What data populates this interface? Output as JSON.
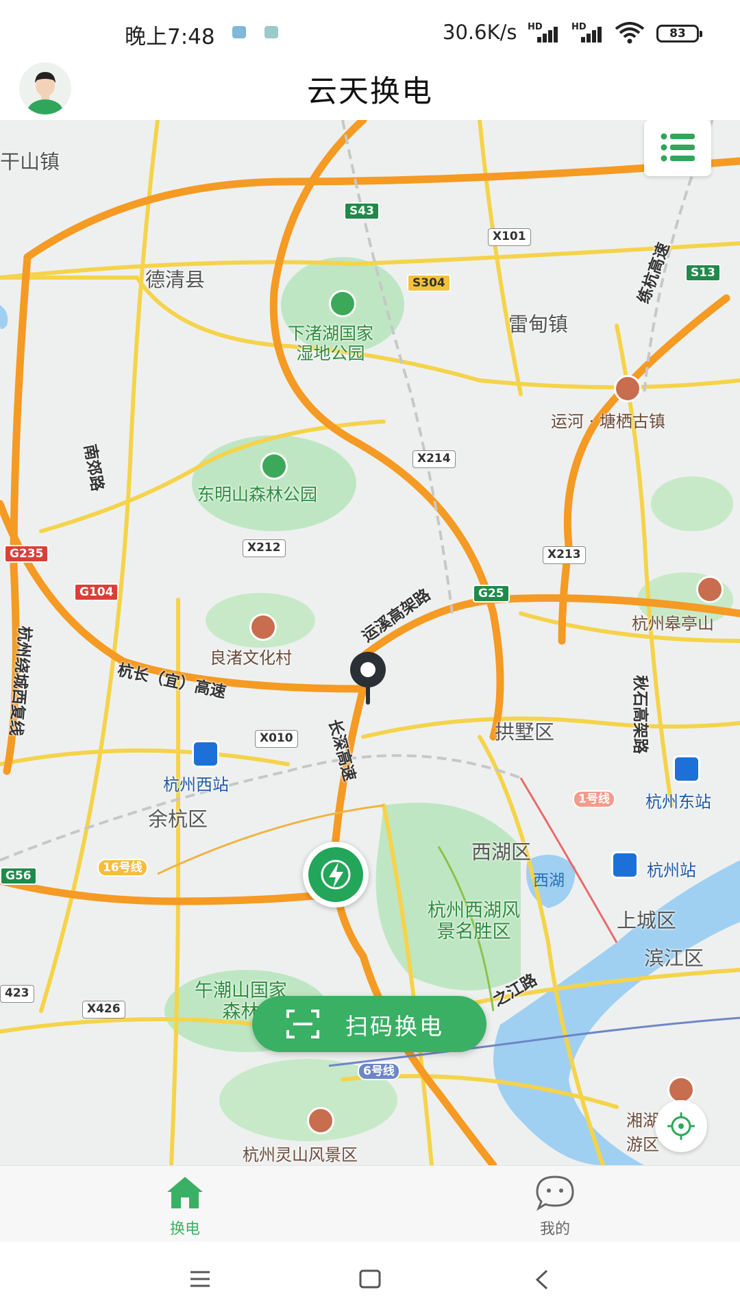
{
  "status_bar": {
    "time": "晚上7:48",
    "speed": "30.6K/s",
    "network_badge": "HD",
    "battery": "83",
    "icons": [
      "camera-app-icon",
      "gallery-app-icon",
      "signal-icon",
      "signal-icon",
      "wifi-icon",
      "battery-icon"
    ]
  },
  "header": {
    "title": "云天换电",
    "avatar": "user-avatar-icon"
  },
  "map": {
    "places": {
      "ganshan": "干山镇",
      "deqing": "德清县",
      "leidian": "雷甸镇",
      "gongshu": "拱墅区",
      "yuhang": "余杭区",
      "xihu_district": "西湖区",
      "shangcheng": "上城区",
      "binjiang": "滨江区"
    },
    "parks": {
      "xiazhuhu": "下渚湖国家\n湿地公园",
      "dongmingshan": "东明山森林公园",
      "xihu_scenic": "杭州西湖风\n景名胜区",
      "wuchaoshan": "午潮山国家\n森林",
      "lingshan": "杭州灵山风景区"
    },
    "pois": {
      "yunhe": "运河 · 塘栖古镇",
      "liangzhu": "良渚文化村",
      "gaoting": "杭州皋亭山",
      "xianghu": "湘湖旅\n游区"
    },
    "stations": {
      "west": "杭州西站",
      "east": "杭州东站",
      "city": "杭州站"
    },
    "roads": {
      "nanjiao": "南郊路",
      "lianghang": "练杭高速",
      "yunxi": "运溪高架路",
      "hangchang": "杭长（宜）高速",
      "changshen": "长深高速",
      "qiushi": "秋石高架路",
      "raocheng": "杭州绕城西复线",
      "zhijiang": "之江路"
    },
    "shields": {
      "s43": "S43",
      "x101": "X101",
      "s304": "S304",
      "s13": "S13",
      "x214": "X214",
      "g235": "G235",
      "x212": "X212",
      "x213": "X213",
      "g104": "G104",
      "g25": "G25",
      "x010": "X010",
      "g56": "G56",
      "x426": "X426",
      "r423": "423"
    },
    "metro": {
      "line1": "1号线",
      "line16": "16号线",
      "line6": "6号线"
    },
    "water": "西湖"
  },
  "controls": {
    "list_button": "list-icon",
    "locate_button": "locate-icon",
    "scan_label": "扫码换电"
  },
  "tabs": {
    "home": "换电",
    "mine": "我的"
  },
  "colors": {
    "brand_green": "#3ab064",
    "marker_green": "#23a55a",
    "expressway": "#f59a23",
    "road_yellow": "#f5d34a"
  }
}
